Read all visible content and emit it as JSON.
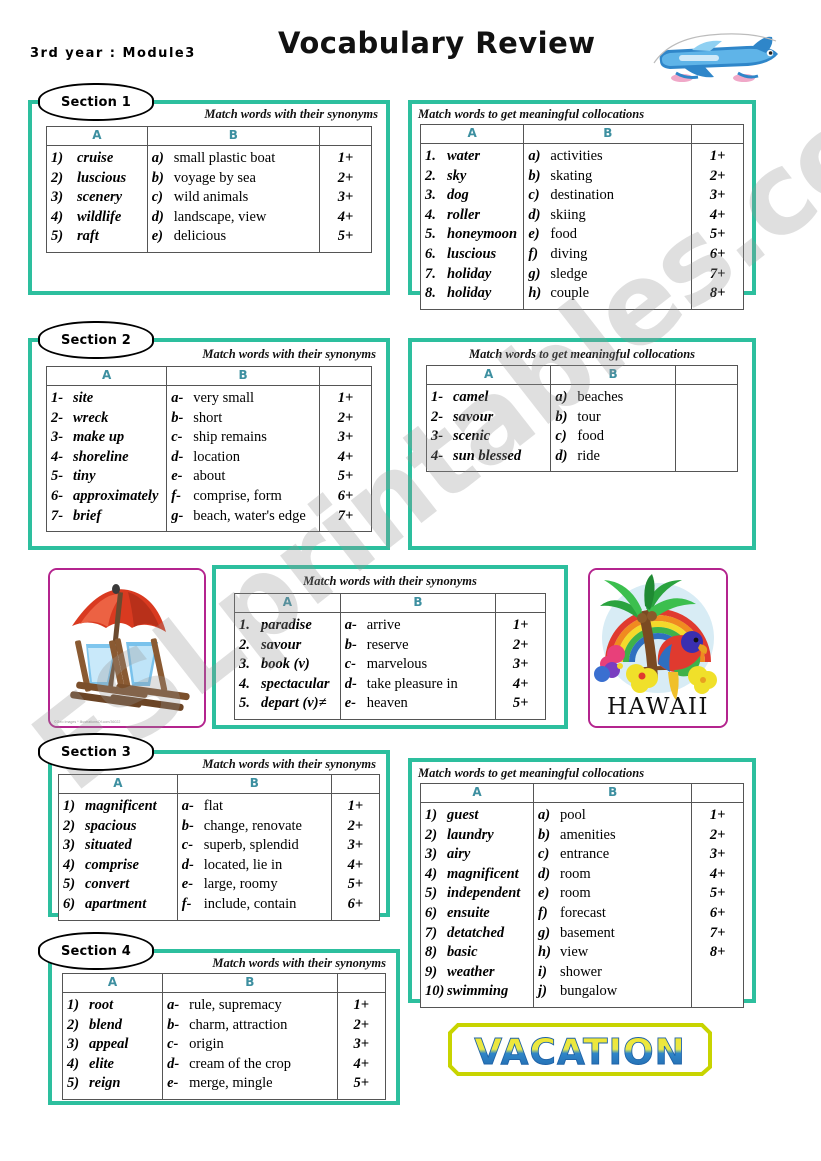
{
  "header": {
    "course_label": "3rd  year : Module3",
    "title": "Vocabulary Review",
    "plane_icon": "airplane-icon"
  },
  "watermark": {
    "text": "ESLprintables.com"
  },
  "titles": {
    "synonyms": "Match words with their synonyms",
    "collocations": "Match words to get meaningful collocations"
  },
  "columns": {
    "a": "A",
    "b": "B",
    "c": ""
  },
  "pictures": {
    "beach": {
      "name": "beach-chairs-umbrella-image",
      "credit": "©Geo Images  *  IllustrationsOf.com/36022"
    },
    "hawaii": {
      "name": "hawaii-parrot-palm-image",
      "caption": "HAWAII"
    },
    "vacation": {
      "name": "vacation-banner-image",
      "text": "VACATION"
    }
  },
  "sections": [
    {
      "badge": "Section 1",
      "left": {
        "title": "Match words with their synonyms",
        "colA": [
          {
            "k": "1)",
            "v": "cruise"
          },
          {
            "k": "2)",
            "v": "luscious"
          },
          {
            "k": "3)",
            "v": "scenery"
          },
          {
            "k": "4)",
            "v": "wildlife"
          },
          {
            "k": "5)",
            "v": "raft"
          }
        ],
        "colB": [
          {
            "k": "a)",
            "v": "small plastic boat"
          },
          {
            "k": "b)",
            "v": "voyage by sea"
          },
          {
            "k": "c)",
            "v": "wild animals"
          },
          {
            "k": "d)",
            "v": "landscape, view"
          },
          {
            "k": "e)",
            "v": "delicious"
          }
        ],
        "colC": [
          "1+",
          "2+",
          "3+",
          "4+",
          "5+"
        ]
      },
      "right": {
        "title": "Match words to get meaningful collocations",
        "colA": [
          {
            "k": "1.",
            "v": "water"
          },
          {
            "k": "2.",
            "v": "sky"
          },
          {
            "k": "3.",
            "v": "dog"
          },
          {
            "k": "4.",
            "v": "roller"
          },
          {
            "k": "5.",
            "v": "honeymoon"
          },
          {
            "k": "6.",
            "v": "luscious"
          },
          {
            "k": "7.",
            "v": "holiday"
          },
          {
            "k": "8.",
            "v": "holiday"
          }
        ],
        "colB": [
          {
            "k": "a)",
            "v": "activities"
          },
          {
            "k": "b)",
            "v": "skating"
          },
          {
            "k": "c)",
            "v": "destination"
          },
          {
            "k": "d)",
            "v": "skiing"
          },
          {
            "k": "e)",
            "v": "food"
          },
          {
            "k": "f)",
            "v": "diving"
          },
          {
            "k": "g)",
            "v": "sledge"
          },
          {
            "k": "h)",
            "v": "couple"
          }
        ],
        "colC": [
          "1+",
          "2+",
          "3+",
          "4+",
          "5+",
          "6+",
          "7+",
          "8+"
        ]
      }
    },
    {
      "badge": "Section 2",
      "left": {
        "title": "Match words with their synonyms",
        "colA": [
          {
            "k": "1-",
            "v": "site"
          },
          {
            "k": "2-",
            "v": "wreck"
          },
          {
            "k": "3-",
            "v": "make up"
          },
          {
            "k": "4-",
            "v": "shoreline"
          },
          {
            "k": "5-",
            "v": "tiny"
          },
          {
            "k": "6-",
            "v": "approximately"
          },
          {
            "k": "7-",
            "v": "brief"
          }
        ],
        "colB": [
          {
            "k": "a-",
            "v": "very small"
          },
          {
            "k": "b-",
            "v": "short"
          },
          {
            "k": "c-",
            "v": "ship remains"
          },
          {
            "k": "d-",
            "v": "location"
          },
          {
            "k": "e-",
            "v": "about"
          },
          {
            "k": "f-",
            "v": "comprise, form"
          },
          {
            "k": "g-",
            "v": "beach, water's edge"
          }
        ],
        "colC": [
          "1+",
          "2+",
          "3+",
          "4+",
          "5+",
          "6+",
          "7+"
        ]
      },
      "right": {
        "title": "Match words to get meaningful collocations",
        "colA": [
          {
            "k": "1-",
            "v": "camel"
          },
          {
            "k": "2-",
            "v": "savour"
          },
          {
            "k": "3-",
            "v": "scenic"
          },
          {
            "k": "4-",
            "v": "sun blessed"
          }
        ],
        "colB": [
          {
            "k": "a)",
            "v": "beaches"
          },
          {
            "k": "b)",
            "v": "tour"
          },
          {
            "k": "c)",
            "v": "food"
          },
          {
            "k": "d)",
            "v": "ride"
          }
        ],
        "colC": []
      }
    },
    {
      "badge": "Section 3",
      "left": {
        "title": "Match words with their synonyms",
        "colA": [
          {
            "k": "1)",
            "v": "magnificent"
          },
          {
            "k": "2)",
            "v": "spacious"
          },
          {
            "k": "3)",
            "v": "situated"
          },
          {
            "k": "4)",
            "v": "comprise"
          },
          {
            "k": "5)",
            "v": "convert"
          },
          {
            "k": "6)",
            "v": "apartment"
          }
        ],
        "colB": [
          {
            "k": "a-",
            "v": "flat"
          },
          {
            "k": "b-",
            "v": "change, renovate"
          },
          {
            "k": "c-",
            "v": "superb, splendid"
          },
          {
            "k": "d-",
            "v": "located, lie in"
          },
          {
            "k": "e-",
            "v": "large, roomy"
          },
          {
            "k": "f-",
            "v": "include, contain"
          }
        ],
        "colC": [
          "1+",
          "2+",
          "3+",
          "4+",
          "5+",
          "6+"
        ]
      },
      "right": {
        "title": "Match words to get meaningful collocations",
        "colA": [
          {
            "k": "1)",
            "v": "guest"
          },
          {
            "k": "2)",
            "v": "laundry"
          },
          {
            "k": "3)",
            "v": "airy"
          },
          {
            "k": "4)",
            "v": "magnificent"
          },
          {
            "k": "5)",
            "v": "independent"
          },
          {
            "k": "6)",
            "v": "ensuite"
          },
          {
            "k": "7)",
            "v": "detatched"
          },
          {
            "k": "8)",
            "v": "basic"
          },
          {
            "k": "9)",
            "v": "weather"
          },
          {
            "k": "10)",
            "v": "swimming"
          }
        ],
        "colB": [
          {
            "k": "a)",
            "v": "pool"
          },
          {
            "k": "b)",
            "v": "amenities"
          },
          {
            "k": "c)",
            "v": "entrance"
          },
          {
            "k": "d)",
            "v": "room"
          },
          {
            "k": "e)",
            "v": "room"
          },
          {
            "k": "f)",
            "v": "forecast"
          },
          {
            "k": "g)",
            "v": "basement"
          },
          {
            "k": "h)",
            "v": "view"
          },
          {
            "k": "i)",
            "v": "shower"
          },
          {
            "k": "j)",
            "v": "bungalow"
          }
        ],
        "colC": [
          "1+",
          "2+",
          "3+",
          "4+",
          "5+",
          "6+",
          "7+",
          "8+"
        ]
      }
    },
    {
      "badge": "Section 4",
      "left": {
        "title": "Match words with their synonyms",
        "colA": [
          {
            "k": "1)",
            "v": "root"
          },
          {
            "k": "2)",
            "v": "blend"
          },
          {
            "k": "3)",
            "v": "appeal"
          },
          {
            "k": "4)",
            "v": "elite"
          },
          {
            "k": "5)",
            "v": "reign"
          }
        ],
        "colB": [
          {
            "k": "a-",
            "v": "rule, supremacy"
          },
          {
            "k": "b-",
            "v": "charm, attraction"
          },
          {
            "k": "c-",
            "v": "origin"
          },
          {
            "k": "d-",
            "v": "cream of the crop"
          },
          {
            "k": "e-",
            "v": "merge, mingle"
          }
        ],
        "colC": [
          "1+",
          "2+",
          "3+",
          "4+",
          "5+"
        ]
      }
    }
  ],
  "middle_panel": {
    "title": "Match words with their synonyms",
    "colA": [
      {
        "k": "1.",
        "v": "paradise"
      },
      {
        "k": "2.",
        "v": "savour"
      },
      {
        "k": "3.",
        "v": "book (v)"
      },
      {
        "k": "4.",
        "v": "spectacular"
      },
      {
        "k": "5.",
        "v": "depart (v)≠"
      }
    ],
    "colB": [
      {
        "k": "a-",
        "v": "arrive"
      },
      {
        "k": "b-",
        "v": "reserve"
      },
      {
        "k": "c-",
        "v": "marvelous"
      },
      {
        "k": "d-",
        "v": "take pleasure in"
      },
      {
        "k": "e-",
        "v": "heaven"
      }
    ],
    "colC": [
      "1+",
      "2+",
      "3+",
      "4+",
      "5+"
    ]
  },
  "colors": {
    "panel_border": "#2dbf9e",
    "picture_border": "#b4248e",
    "column_header": "#3d8fa0",
    "banner_border": "#c8d400"
  }
}
